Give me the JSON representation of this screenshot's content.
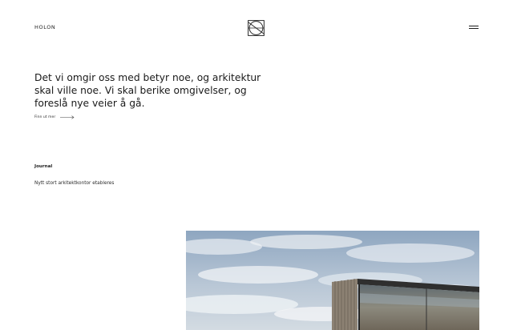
{
  "header": {
    "brand": "HOLON",
    "logo_icon": "holon-monogram-icon",
    "menu_icon": "hamburger-menu-icon"
  },
  "hero": {
    "headline": "Det vi omgir oss med betyr noe, og arkitektur skal ville noe. Vi skal berike omgivelser, og foreslå nye veier å gå.",
    "more_link": "Finn ut mer",
    "more_icon": "arrow-right-icon"
  },
  "journal": {
    "heading": "Journal",
    "items": [
      {
        "title": "Nytt stort arkitektkontor etableres"
      }
    ]
  },
  "featured_image": {
    "subject": "modern-building-photo"
  }
}
